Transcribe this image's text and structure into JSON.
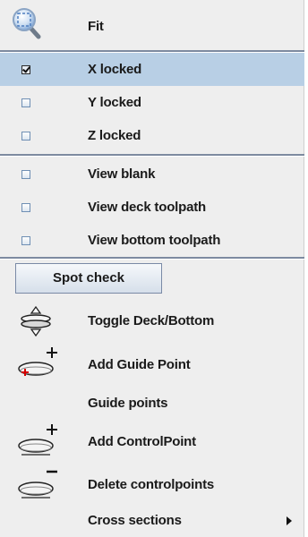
{
  "menu": {
    "fit_label": "Fit",
    "x_locked_label": "X locked",
    "y_locked_label": "Y locked",
    "z_locked_label": "Z locked",
    "view_blank_label": "View blank",
    "view_deck_toolpath_label": "View deck toolpath",
    "view_bottom_toolpath_label": "View bottom toolpath",
    "spot_check_label": "Spot check",
    "toggle_deck_bottom_label": "Toggle Deck/Bottom",
    "add_guide_point_label": "Add Guide Point",
    "guide_points_label": "Guide points",
    "add_controlpoint_label": "Add ControlPoint",
    "delete_controlpoints_label": "Delete controlpoints",
    "cross_sections_label": "Cross sections"
  },
  "state": {
    "x_locked": true,
    "y_locked": false,
    "z_locked": false,
    "view_blank": false,
    "view_deck_toolpath": false,
    "view_bottom_toolpath": false,
    "highlighted_item": "X locked"
  },
  "colors": {
    "menu_background": "#eeeeee",
    "highlight": "#b8cfe5",
    "separator": "#7d8aa0",
    "text": "#1a1a1a"
  },
  "icons": {
    "fit": "magnifier-icon",
    "toggle": "toggle-deck-bottom-icon",
    "add_guide_point": "add-guide-point-icon",
    "add_controlpoint": "add-controlpoint-icon",
    "delete_controlpoints": "delete-controlpoints-icon",
    "submenu": "submenu-arrow-icon"
  }
}
